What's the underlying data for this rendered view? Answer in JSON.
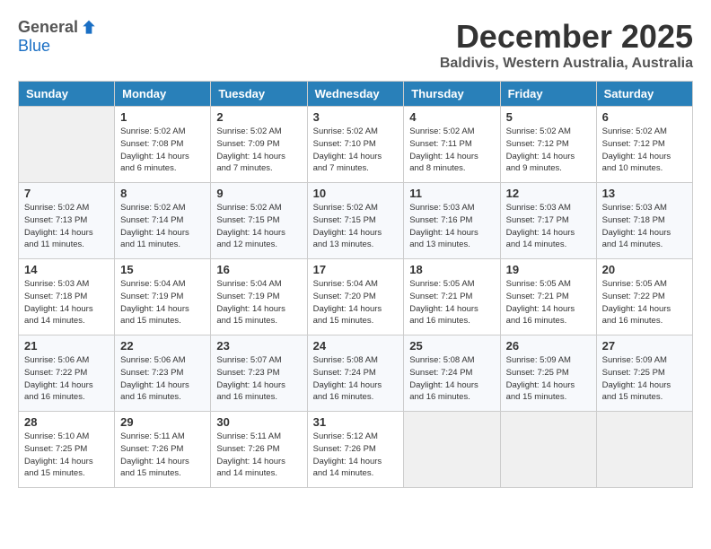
{
  "header": {
    "logo_general": "General",
    "logo_blue": "Blue",
    "title": "December 2025",
    "subtitle": "Baldivis, Western Australia, Australia"
  },
  "calendar": {
    "columns": [
      "Sunday",
      "Monday",
      "Tuesday",
      "Wednesday",
      "Thursday",
      "Friday",
      "Saturday"
    ],
    "weeks": [
      [
        {
          "day": "",
          "info": ""
        },
        {
          "day": "1",
          "info": "Sunrise: 5:02 AM\nSunset: 7:08 PM\nDaylight: 14 hours\nand 6 minutes."
        },
        {
          "day": "2",
          "info": "Sunrise: 5:02 AM\nSunset: 7:09 PM\nDaylight: 14 hours\nand 7 minutes."
        },
        {
          "day": "3",
          "info": "Sunrise: 5:02 AM\nSunset: 7:10 PM\nDaylight: 14 hours\nand 7 minutes."
        },
        {
          "day": "4",
          "info": "Sunrise: 5:02 AM\nSunset: 7:11 PM\nDaylight: 14 hours\nand 8 minutes."
        },
        {
          "day": "5",
          "info": "Sunrise: 5:02 AM\nSunset: 7:12 PM\nDaylight: 14 hours\nand 9 minutes."
        },
        {
          "day": "6",
          "info": "Sunrise: 5:02 AM\nSunset: 7:12 PM\nDaylight: 14 hours\nand 10 minutes."
        }
      ],
      [
        {
          "day": "7",
          "info": "Sunrise: 5:02 AM\nSunset: 7:13 PM\nDaylight: 14 hours\nand 11 minutes."
        },
        {
          "day": "8",
          "info": "Sunrise: 5:02 AM\nSunset: 7:14 PM\nDaylight: 14 hours\nand 11 minutes."
        },
        {
          "day": "9",
          "info": "Sunrise: 5:02 AM\nSunset: 7:15 PM\nDaylight: 14 hours\nand 12 minutes."
        },
        {
          "day": "10",
          "info": "Sunrise: 5:02 AM\nSunset: 7:15 PM\nDaylight: 14 hours\nand 13 minutes."
        },
        {
          "day": "11",
          "info": "Sunrise: 5:03 AM\nSunset: 7:16 PM\nDaylight: 14 hours\nand 13 minutes."
        },
        {
          "day": "12",
          "info": "Sunrise: 5:03 AM\nSunset: 7:17 PM\nDaylight: 14 hours\nand 14 minutes."
        },
        {
          "day": "13",
          "info": "Sunrise: 5:03 AM\nSunset: 7:18 PM\nDaylight: 14 hours\nand 14 minutes."
        }
      ],
      [
        {
          "day": "14",
          "info": "Sunrise: 5:03 AM\nSunset: 7:18 PM\nDaylight: 14 hours\nand 14 minutes."
        },
        {
          "day": "15",
          "info": "Sunrise: 5:04 AM\nSunset: 7:19 PM\nDaylight: 14 hours\nand 15 minutes."
        },
        {
          "day": "16",
          "info": "Sunrise: 5:04 AM\nSunset: 7:19 PM\nDaylight: 14 hours\nand 15 minutes."
        },
        {
          "day": "17",
          "info": "Sunrise: 5:04 AM\nSunset: 7:20 PM\nDaylight: 14 hours\nand 15 minutes."
        },
        {
          "day": "18",
          "info": "Sunrise: 5:05 AM\nSunset: 7:21 PM\nDaylight: 14 hours\nand 16 minutes."
        },
        {
          "day": "19",
          "info": "Sunrise: 5:05 AM\nSunset: 7:21 PM\nDaylight: 14 hours\nand 16 minutes."
        },
        {
          "day": "20",
          "info": "Sunrise: 5:05 AM\nSunset: 7:22 PM\nDaylight: 14 hours\nand 16 minutes."
        }
      ],
      [
        {
          "day": "21",
          "info": "Sunrise: 5:06 AM\nSunset: 7:22 PM\nDaylight: 14 hours\nand 16 minutes."
        },
        {
          "day": "22",
          "info": "Sunrise: 5:06 AM\nSunset: 7:23 PM\nDaylight: 14 hours\nand 16 minutes."
        },
        {
          "day": "23",
          "info": "Sunrise: 5:07 AM\nSunset: 7:23 PM\nDaylight: 14 hours\nand 16 minutes."
        },
        {
          "day": "24",
          "info": "Sunrise: 5:08 AM\nSunset: 7:24 PM\nDaylight: 14 hours\nand 16 minutes."
        },
        {
          "day": "25",
          "info": "Sunrise: 5:08 AM\nSunset: 7:24 PM\nDaylight: 14 hours\nand 16 minutes."
        },
        {
          "day": "26",
          "info": "Sunrise: 5:09 AM\nSunset: 7:25 PM\nDaylight: 14 hours\nand 15 minutes."
        },
        {
          "day": "27",
          "info": "Sunrise: 5:09 AM\nSunset: 7:25 PM\nDaylight: 14 hours\nand 15 minutes."
        }
      ],
      [
        {
          "day": "28",
          "info": "Sunrise: 5:10 AM\nSunset: 7:25 PM\nDaylight: 14 hours\nand 15 minutes."
        },
        {
          "day": "29",
          "info": "Sunrise: 5:11 AM\nSunset: 7:26 PM\nDaylight: 14 hours\nand 15 minutes."
        },
        {
          "day": "30",
          "info": "Sunrise: 5:11 AM\nSunset: 7:26 PM\nDaylight: 14 hours\nand 14 minutes."
        },
        {
          "day": "31",
          "info": "Sunrise: 5:12 AM\nSunset: 7:26 PM\nDaylight: 14 hours\nand 14 minutes."
        },
        {
          "day": "",
          "info": ""
        },
        {
          "day": "",
          "info": ""
        },
        {
          "day": "",
          "info": ""
        }
      ]
    ]
  }
}
